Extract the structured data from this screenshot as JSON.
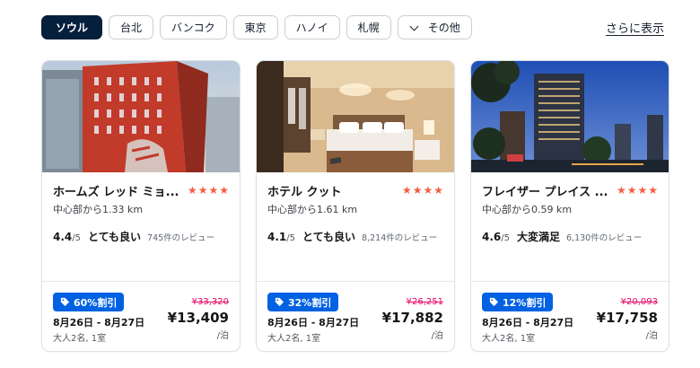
{
  "tabs": [
    {
      "label": "ソウル",
      "active": true
    },
    {
      "label": "台北"
    },
    {
      "label": "バンコク"
    },
    {
      "label": "東京"
    },
    {
      "label": "ハノイ"
    },
    {
      "label": "札幌"
    }
  ],
  "more_tab": {
    "label": "その他",
    "icon": "chevron-down-icon"
  },
  "show_more": "さらに表示",
  "colors": {
    "accent": "#05203c",
    "deal_badge": "#0062e3",
    "star": "#f55d42",
    "strike_price": "#e70866"
  },
  "hotels": [
    {
      "name": "ホームズ レッド ミョ...",
      "stars": 4,
      "distance": "中心部から1.33 km",
      "score": "4.4",
      "score_max": "/5",
      "label": "とても良い",
      "reviews": "745件のレビュー",
      "deal": "60%割引",
      "original_price": "¥33,320",
      "dates": "8月26日 - 8月27日",
      "guests": "大人2名, 1室",
      "price": "¥13,409",
      "per": "/泊"
    },
    {
      "name": "ホテル クット",
      "stars": 4,
      "distance": "中心部から1.61 km",
      "score": "4.1",
      "score_max": "/5",
      "label": "とても良い",
      "reviews": "8,214件のレビュー",
      "deal": "32%割引",
      "original_price": "¥26,251",
      "dates": "8月26日 - 8月27日",
      "guests": "大人2名, 1室",
      "price": "¥17,882",
      "per": "/泊"
    },
    {
      "name": "フレイザー プレイス ...",
      "stars": 4,
      "distance": "中心部から0.59 km",
      "score": "4.6",
      "score_max": "/5",
      "label": "大変満足",
      "reviews": "6,130件のレビュー",
      "deal": "12%割引",
      "original_price": "¥20,093",
      "dates": "8月26日 - 8月27日",
      "guests": "大人2名, 1室",
      "price": "¥17,758",
      "per": "/泊"
    }
  ]
}
